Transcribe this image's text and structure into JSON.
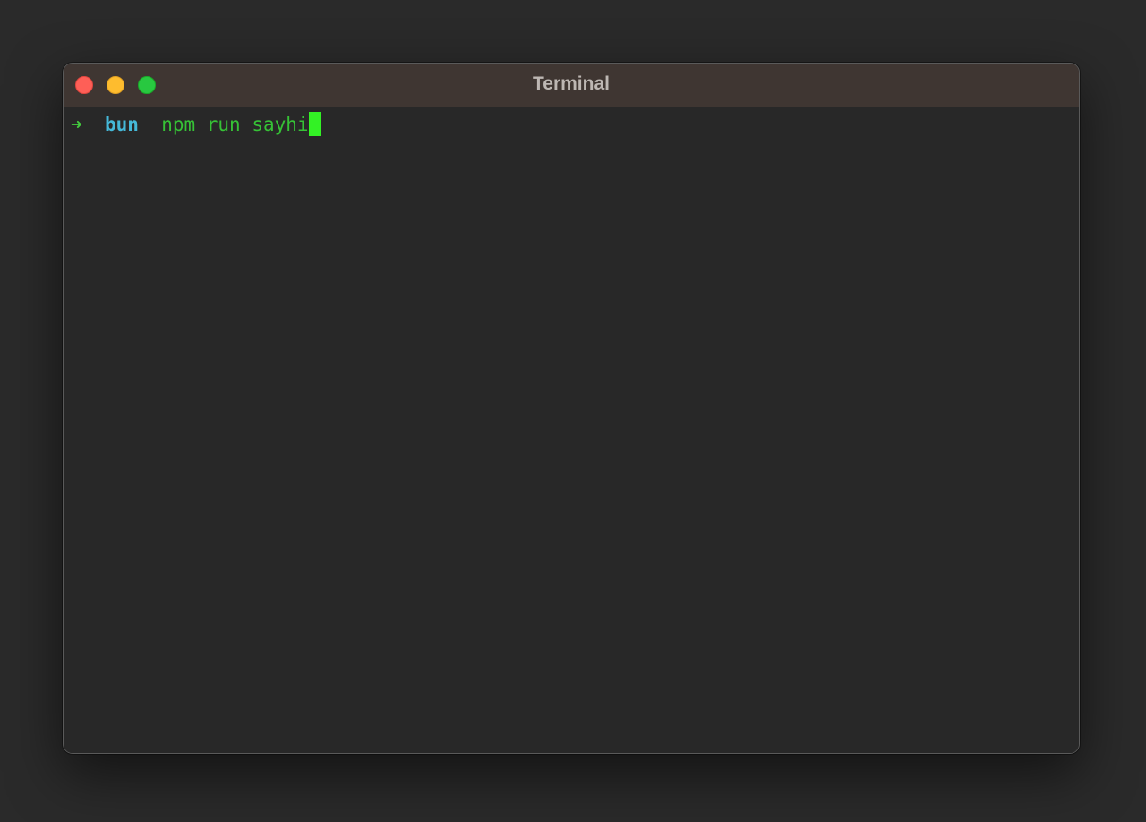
{
  "window": {
    "title": "Terminal"
  },
  "terminal": {
    "prompt_symbol": "➜",
    "directory": "bun",
    "command": "npm run sayhi"
  },
  "colors": {
    "close": "#fe5f57",
    "minimize": "#febc2e",
    "zoom": "#28c840",
    "prompt_arrow": "#43cc3e",
    "directory": "#45b8d8",
    "command": "#36c236",
    "cursor": "#33f225"
  }
}
